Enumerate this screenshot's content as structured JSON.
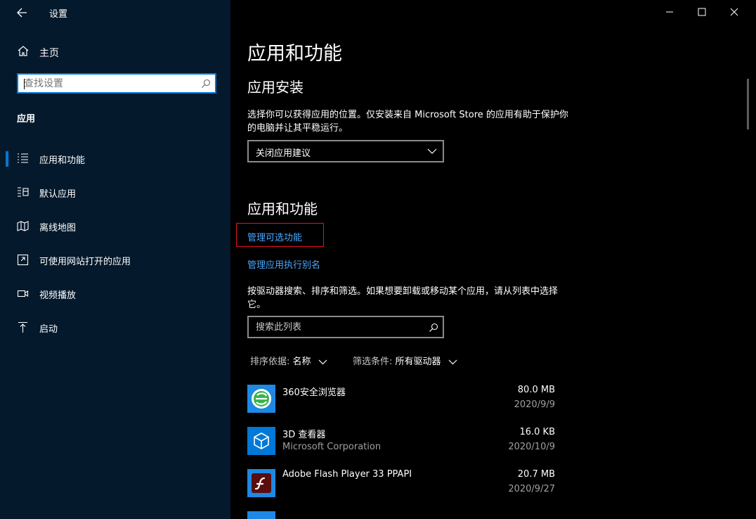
{
  "window": {
    "title": "设置",
    "controls": {
      "minimize_icon": "minimize-icon",
      "maximize_icon": "maximize-icon",
      "close_icon": "close-icon"
    }
  },
  "sidebar": {
    "home_label": "主页",
    "search_placeholder": "查找设置",
    "section_heading": "应用",
    "items": [
      {
        "label": "应用和功能",
        "icon": "apps-list-icon",
        "selected": true
      },
      {
        "label": "默认应用",
        "icon": "default-apps-icon",
        "selected": false
      },
      {
        "label": "离线地图",
        "icon": "offline-maps-icon",
        "selected": false
      },
      {
        "label": "可使用网站打开的应用",
        "icon": "apps-for-websites-icon",
        "selected": false
      },
      {
        "label": "视频播放",
        "icon": "video-playback-icon",
        "selected": false
      },
      {
        "label": "启动",
        "icon": "startup-icon",
        "selected": false
      }
    ]
  },
  "main": {
    "page_title": "应用和功能",
    "install_section": {
      "heading": "应用安装",
      "description": "选择你可以获得应用的位置。仅安装来自 Microsoft Store 的应用有助于保护你的电脑并让其平稳运行。",
      "dropdown_value": "关闭应用建议"
    },
    "apps_section": {
      "heading": "应用和功能",
      "manage_optional_link": "管理可选功能",
      "manage_alias_link": "管理应用执行别名",
      "list_description": "按驱动器搜索、排序和筛选。如果想要卸载或移动某个应用，请从列表中选择它。",
      "search_placeholder": "搜索此列表",
      "sort_label": "排序依据:",
      "sort_value": "名称",
      "filter_label": "筛选条件:",
      "filter_value": "所有驱动器"
    },
    "apps": [
      {
        "name": "360安全浏览器",
        "publisher": "",
        "size": "80.0 MB",
        "date": "2020/9/9",
        "icon": "360-browser-icon"
      },
      {
        "name": "3D 查看器",
        "publisher": "Microsoft Corporation",
        "size": "16.0 KB",
        "date": "2020/10/9",
        "icon": "3d-viewer-icon"
      },
      {
        "name": "Adobe Flash Player 33 PPAPI",
        "publisher": "",
        "size": "20.7 MB",
        "date": "2020/9/27",
        "icon": "flash-player-icon"
      }
    ]
  },
  "colors": {
    "sidebar_bg": "#04192c",
    "main_bg": "#000000",
    "accent": "#0078d7",
    "link": "#4aa8ff",
    "highlight_box": "#e81123"
  }
}
